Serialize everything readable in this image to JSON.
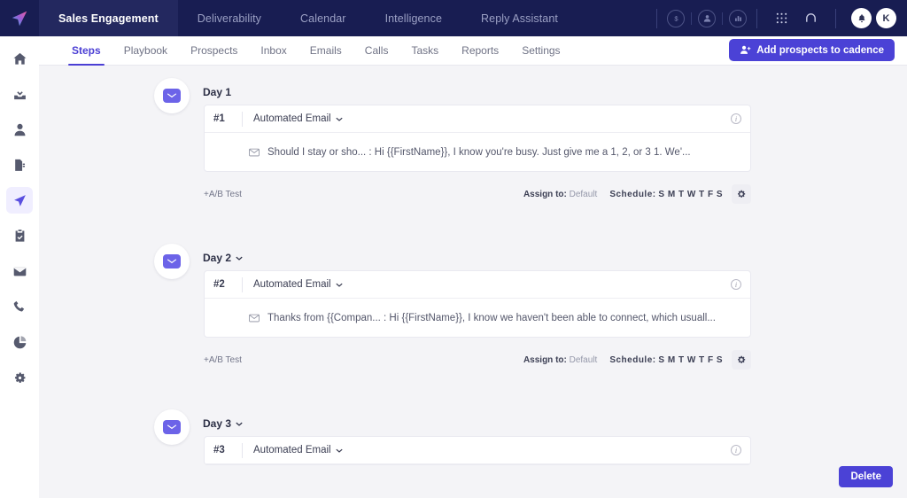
{
  "app": {
    "logo_icon": "paper-plane-logo",
    "avatar_initial": "K"
  },
  "topnav": {
    "items": [
      {
        "label": "Sales Engagement",
        "active": true
      },
      {
        "label": "Deliverability",
        "active": false
      },
      {
        "label": "Calendar",
        "active": false
      },
      {
        "label": "Intelligence",
        "active": false
      },
      {
        "label": "Reply Assistant",
        "active": false
      }
    ],
    "icons": [
      {
        "name": "dollar-circle-icon",
        "glyph": "$"
      },
      {
        "name": "person-circle-icon",
        "glyph": "●"
      },
      {
        "name": "chart-circle-icon",
        "glyph": "█"
      },
      {
        "name": "grid-apps-icon",
        "glyph": "∷"
      },
      {
        "name": "headset-support-icon",
        "glyph": "Ω"
      },
      {
        "name": "notification-bell-icon",
        "glyph": "🔔"
      }
    ]
  },
  "sidebar": {
    "items": [
      {
        "name": "home-icon",
        "label": "Home",
        "active": false
      },
      {
        "name": "inbox-download-icon",
        "label": "Inbox",
        "active": false
      },
      {
        "name": "person-icon",
        "label": "Contacts",
        "active": false
      },
      {
        "name": "document-icon",
        "label": "Templates",
        "active": false
      },
      {
        "name": "paper-plane-icon",
        "label": "Cadences",
        "active": true
      },
      {
        "name": "clipboard-check-icon",
        "label": "Tasks",
        "active": false
      },
      {
        "name": "envelope-icon",
        "label": "Emails",
        "active": false
      },
      {
        "name": "phone-icon",
        "label": "Calls",
        "active": false
      },
      {
        "name": "pie-chart-icon",
        "label": "Reports",
        "active": false
      },
      {
        "name": "gear-icon",
        "label": "Settings",
        "active": false
      }
    ]
  },
  "subnav": {
    "tabs": [
      {
        "label": "Steps",
        "active": true
      },
      {
        "label": "Playbook",
        "active": false
      },
      {
        "label": "Prospects",
        "active": false
      },
      {
        "label": "Inbox",
        "active": false
      },
      {
        "label": "Emails",
        "active": false
      },
      {
        "label": "Calls",
        "active": false
      },
      {
        "label": "Tasks",
        "active": false
      },
      {
        "label": "Reports",
        "active": false
      },
      {
        "label": "Settings",
        "active": false
      }
    ],
    "add_button_label": "Add prospects to cadence",
    "add_button_icon": "person-plus-icon"
  },
  "steps": [
    {
      "day_label": "Day 1",
      "has_chevron": false,
      "step_number": "#1",
      "step_type": "Automated Email",
      "badge_icon": "envelope-icon",
      "preview": "Should I stay or sho... : Hi {{FirstName}}, I know you're busy. Just give me a 1, 2, or 3 1. We'...",
      "ab_test_label": "+A/B Test",
      "assign_label": "Assign to:",
      "assign_value": "Default",
      "schedule_label": "Schedule:",
      "schedule_days": "S M T W T F S",
      "has_footer": true,
      "has_body": true
    },
    {
      "day_label": "Day 2",
      "has_chevron": true,
      "step_number": "#2",
      "step_type": "Automated Email",
      "badge_icon": "envelope-icon",
      "preview": "Thanks from {{Compan... : Hi {{FirstName}}, I know we haven't been able to connect, which usuall...",
      "ab_test_label": "+A/B Test",
      "assign_label": "Assign to:",
      "assign_value": "Default",
      "schedule_label": "Schedule:",
      "schedule_days": "S M T W T F S",
      "has_footer": true,
      "has_body": true
    },
    {
      "day_label": "Day 3",
      "has_chevron": true,
      "step_number": "#3",
      "step_type": "Automated Email",
      "badge_icon": "envelope-icon",
      "preview": "",
      "ab_test_label": "",
      "assign_label": "",
      "assign_value": "",
      "schedule_label": "",
      "schedule_days": "",
      "has_footer": false,
      "has_body": false
    }
  ],
  "footer": {
    "delete_label": "Delete"
  },
  "colors": {
    "topbar": "#181d52",
    "topbar_active": "#23285f",
    "accent": "#4b42d6",
    "accent_soft": "#6c63e8",
    "canvas": "#f4f4f7",
    "card": "#ffffff"
  }
}
